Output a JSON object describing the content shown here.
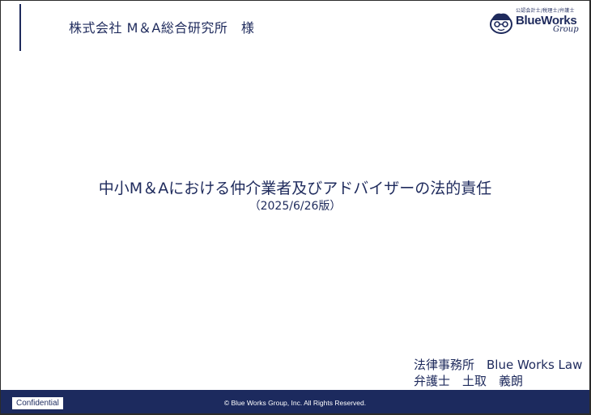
{
  "header": {
    "client_name": "株式会社 M＆A総合研究所　様"
  },
  "logo": {
    "tagline": "公認会計士/税理士/弁護士",
    "wordmark": "BlueWorks",
    "group": "Group"
  },
  "title": {
    "main": "中小M＆Aにおける仲介業者及びアドバイザーの法的責任",
    "sub": "（2025/6/26版）"
  },
  "firm": {
    "name": "法律事務所　Blue Works Law",
    "author": "弁護士　土取　義朗"
  },
  "footer": {
    "badge": "Confidential",
    "copyright": "© Blue Works Group, Inc.  All Rights Reserved."
  },
  "colors": {
    "brand_navy": "#1c2a5e",
    "text_navy": "#1e2a5c",
    "background": "#ffffff"
  }
}
